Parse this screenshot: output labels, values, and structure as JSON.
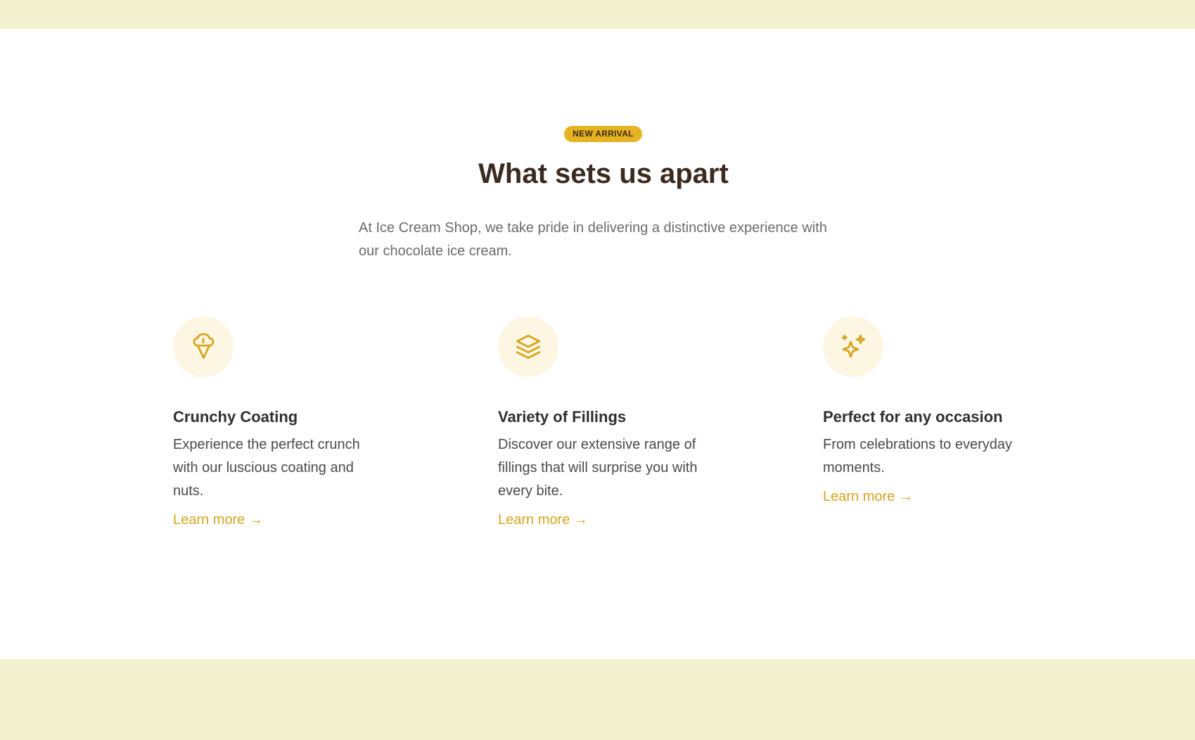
{
  "badge": {
    "label": "NEW ARRIVAL"
  },
  "section": {
    "title": "What sets us apart",
    "intro": "At Ice Cream Shop, we take pride in delivering a distinctive experience with our chocolate ice cream."
  },
  "features": [
    {
      "icon": "ice-cream-icon",
      "title": "Crunchy Coating",
      "description": "Experience the perfect crunch with our luscious coating and nuts.",
      "link_label": "Learn more →"
    },
    {
      "icon": "layers-icon",
      "title": "Variety of Fillings",
      "description": "Discover our extensive range of fillings that will surprise you with every bite.",
      "link_label": "Learn more →"
    },
    {
      "icon": "sparkles-icon",
      "title": "Perfect for any occasion",
      "description": "From celebrations to everyday moments.",
      "link_label": "Learn more →"
    }
  ],
  "colors": {
    "band": "#f1f1d0",
    "accent": "#e6b422",
    "link": "#d6a51e",
    "icon_bg": "#fdf6e3",
    "title": "#3b2a1f"
  }
}
